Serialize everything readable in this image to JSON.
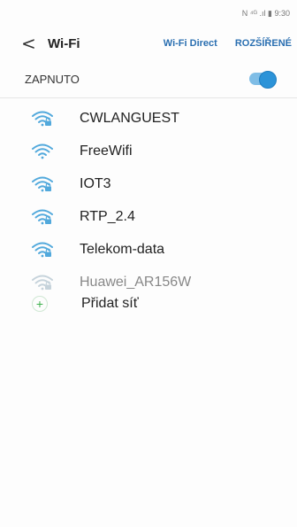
{
  "status_bar": {
    "text": "N ⁴ᴳ .ıl ▮ 9:30"
  },
  "header": {
    "back_icon": "chevron-left-icon",
    "title": "Wi-Fi",
    "wifi_direct_label": "Wi-Fi Direct",
    "advanced_label": "ROZŠÍŘENÉ"
  },
  "toggle": {
    "label": "ZAPNUTO",
    "state": "on",
    "accent": "#2c93d8"
  },
  "networks": [
    {
      "name": "CWLANGUEST",
      "secured": true
    },
    {
      "name": "FreeWifi",
      "secured": false
    },
    {
      "name": "IOT3",
      "secured": true
    },
    {
      "name": "RTP_2.4",
      "secured": true
    },
    {
      "name": "Telekom-data",
      "secured": true
    },
    {
      "name": "Huawei_AR156W",
      "secured": true,
      "dim": true
    }
  ],
  "add_network": {
    "label": "Přidat síť",
    "icon": "plus-icon"
  }
}
